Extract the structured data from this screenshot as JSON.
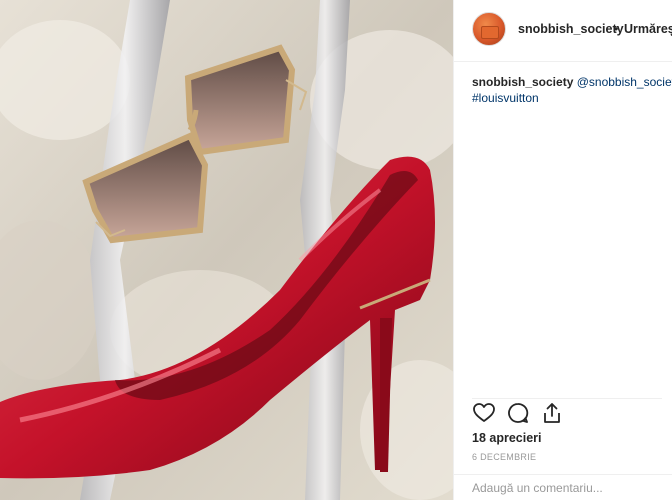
{
  "post": {
    "username": "snobbish_society",
    "separator": "•",
    "follow_label": "Urmărește",
    "caption_username": "snobbish_society",
    "caption_mention": "@snobbish_society",
    "caption_hashtag": "#louisvuitton",
    "likes_text": "18 aprecieri",
    "date_text": "6 DECEMBRIE",
    "comment_placeholder": "Adaugă un comentariu..."
  },
  "icons": {
    "like": "heart-icon",
    "comment": "speech-bubble-icon",
    "share": "share-icon"
  },
  "colors": {
    "link": "#003569",
    "text": "#262626",
    "muted": "#999999",
    "shoe": "#c4122a"
  }
}
